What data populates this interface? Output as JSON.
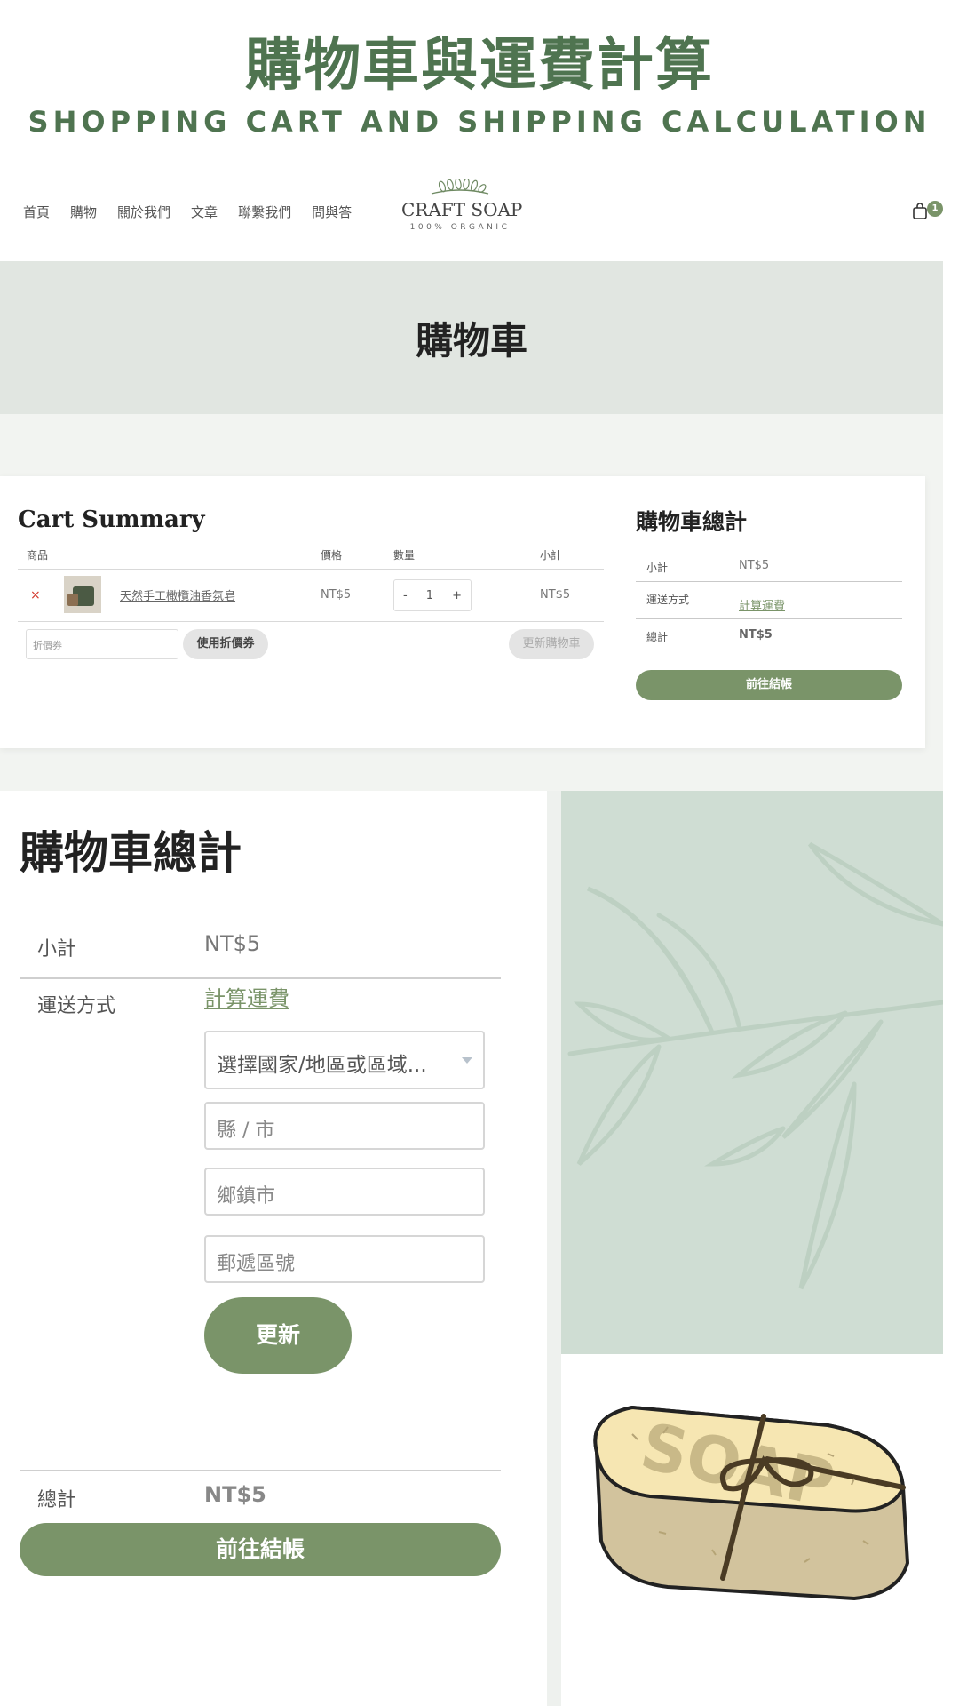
{
  "header": {
    "title_zh": "購物車與運費計算",
    "title_en": "SHOPPING CART AND SHIPPING CALCULATION"
  },
  "nav": {
    "links": [
      "首頁",
      "購物",
      "關於我們",
      "文章",
      "聯繫我們",
      "問與答"
    ],
    "logo_name": "CRAFT SOAP",
    "logo_tag": "100% ORGANIC",
    "cart_count": "1"
  },
  "banner": {
    "title": "購物車"
  },
  "cart_summary": {
    "title": "Cart Summary",
    "columns": {
      "product": "商品",
      "price": "價格",
      "quantity": "數量",
      "subtotal": "小計"
    },
    "item": {
      "remove": "×",
      "name": "天然手工橄欖油香氛皂",
      "price": "NT$5",
      "qty_minus": "-",
      "quantity": "1",
      "qty_plus": "+",
      "subtotal": "NT$5"
    },
    "coupon_placeholder": "折價券",
    "apply_coupon": "使用折價券",
    "update_cart": "更新購物車"
  },
  "totals_small": {
    "title": "購物車總計",
    "subtotal_label": "小計",
    "subtotal_value": "NT$5",
    "shipping_label": "運送方式",
    "shipping_link": "計算運費",
    "total_label": "總計",
    "total_value": "NT$5",
    "checkout": "前往結帳"
  },
  "totals_large": {
    "title": "購物車總計",
    "subtotal_label": "小計",
    "subtotal_value": "NT$5",
    "shipping_label": "運送方式",
    "shipping_link": "計算運費",
    "country_select": "選擇國家/地區或區域...",
    "county_placeholder": "縣 / 市",
    "town_placeholder": "鄉鎮市",
    "postcode_placeholder": "郵遞區號",
    "update": "更新",
    "total_label": "總計",
    "total_value": "NT$5",
    "checkout": "前往結帳"
  },
  "illustration": {
    "soap_text": "SOAP"
  },
  "colors": {
    "brand_green": "#7a9469",
    "title_green": "#4f7450",
    "banner_bg": "#e1e6e1",
    "leaf_panel": "#cfddd3",
    "remove_red": "#d43b2f"
  }
}
